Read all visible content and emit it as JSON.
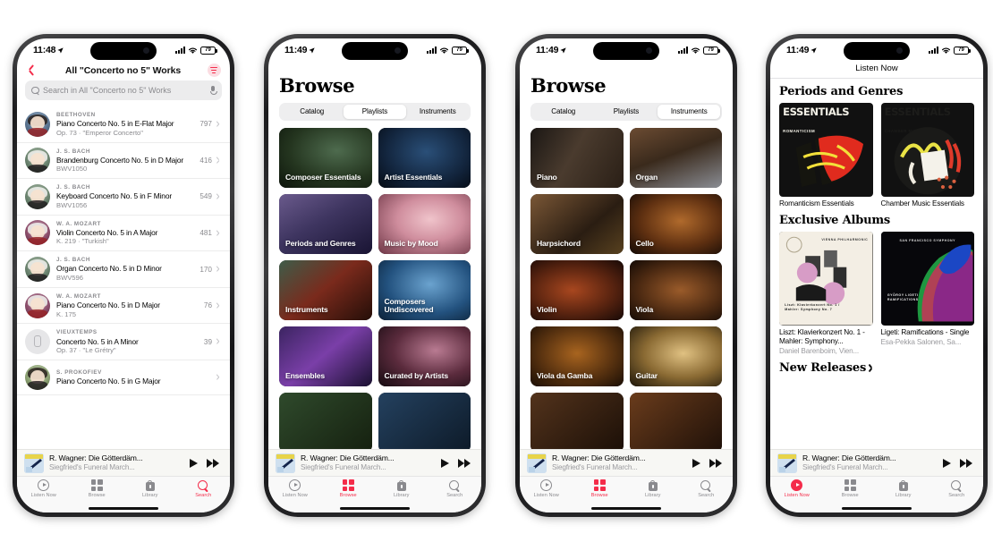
{
  "status_bar": {
    "time_p1": "11:48",
    "time_p2": "11:49",
    "time_p3": "11:49",
    "time_p4": "11:49",
    "battery": "79",
    "signal_icon": "cellular-bars-icon",
    "wifi_icon": "wifi-icon",
    "battery_icon": "battery-icon",
    "location_icon": "location-arrow-icon"
  },
  "now_playing": {
    "title": "R. Wagner: Die Götterdäm...",
    "subtitle": "Siegfried's Funeral March...",
    "play_icon": "play-icon",
    "forward_icon": "fast-forward-icon",
    "artwork_name": "now-playing-artwork"
  },
  "tab_bar": {
    "items": [
      {
        "label": "Listen Now",
        "icon": "listen-now-icon"
      },
      {
        "label": "Browse",
        "icon": "browse-grid-icon"
      },
      {
        "label": "Library",
        "icon": "library-bag-icon"
      },
      {
        "label": "Search",
        "icon": "search-magnifier-icon"
      }
    ],
    "accent_color": "#f42c4a",
    "inactive_color": "#8a8a8e"
  },
  "phone1": {
    "nav": {
      "back_icon": "back-chevron-icon",
      "title": "All \"Concerto no 5\" Works",
      "filter_icon": "filter-lines-icon"
    },
    "search": {
      "placeholder": "Search in All \"Concerto no 5\" Works",
      "search_icon": "search-magnifier-icon",
      "mic_icon": "microphone-icon"
    },
    "works": [
      {
        "composer": "BEETHOVEN",
        "title": "Piano Concerto No. 5 in E-Flat Major",
        "sub": "Op. 73 · \"Emperor Concerto\"",
        "count": "797",
        "avatar": "av-beeth"
      },
      {
        "composer": "J. S. BACH",
        "title": "Brandenburg Concerto No. 5 in D Major",
        "sub": "BWV1050",
        "count": "416",
        "avatar": "av-bach"
      },
      {
        "composer": "J. S. BACH",
        "title": "Keyboard Concerto No. 5 in F Minor",
        "sub": "BWV1056",
        "count": "549",
        "avatar": "av-bach"
      },
      {
        "composer": "W. A. MOZART",
        "title": "Violin Concerto No. 5 in A Major",
        "sub": "K. 219 · \"Turkish\"",
        "count": "481",
        "avatar": "av-moz"
      },
      {
        "composer": "J. S. BACH",
        "title": "Organ Concerto No. 5 in D Minor",
        "sub": "BWV596",
        "count": "170",
        "avatar": "av-bach"
      },
      {
        "composer": "W. A. MOZART",
        "title": "Piano Concerto No. 5 in D Major",
        "sub": "K. 175",
        "count": "76",
        "avatar": "av-moz"
      },
      {
        "composer": "VIEUXTEMPS",
        "title": "Concerto No. 5 in A Minor",
        "sub": "Op. 37 · \"Le Grétry\"",
        "count": "39",
        "avatar": "av-gray"
      },
      {
        "composer": "S. PROKOFIEV",
        "title": "Piano Concerto No. 5 in G Major",
        "sub": "",
        "count": "",
        "avatar": "av-prok"
      }
    ],
    "active_tab": "Search"
  },
  "phone2": {
    "title": "Browse",
    "segments": [
      {
        "label": "Catalog",
        "active": false
      },
      {
        "label": "Playlists",
        "active": true
      },
      {
        "label": "Instruments",
        "active": false
      }
    ],
    "cards": [
      {
        "label": "Composer Essentials",
        "art": "art-composer"
      },
      {
        "label": "Artist Essentials",
        "art": "art-artist"
      },
      {
        "label": "Periods and Genres",
        "art": "art-periods"
      },
      {
        "label": "Music by Mood",
        "art": "art-mood"
      },
      {
        "label": "Instruments",
        "art": "art-instr"
      },
      {
        "label": "Composers Undiscovered",
        "art": "art-undis"
      },
      {
        "label": "Ensembles",
        "art": "art-ens"
      },
      {
        "label": "Curated by Artists",
        "art": "art-curated"
      },
      {
        "label": "",
        "art": "art-extra1"
      },
      {
        "label": "",
        "art": "art-extra2"
      }
    ],
    "active_tab": "Browse"
  },
  "phone3": {
    "title": "Browse",
    "segments": [
      {
        "label": "Catalog",
        "active": false
      },
      {
        "label": "Playlists",
        "active": false
      },
      {
        "label": "Instruments",
        "active": true
      }
    ],
    "cards": [
      {
        "label": "Piano",
        "art": "art-piano"
      },
      {
        "label": "Organ",
        "art": "art-organ"
      },
      {
        "label": "Harpsichord",
        "art": "art-harps"
      },
      {
        "label": "Cello",
        "art": "art-cello"
      },
      {
        "label": "Violin",
        "art": "art-violin"
      },
      {
        "label": "Viola",
        "art": "art-viola"
      },
      {
        "label": "Viola da Gamba",
        "art": "art-gamba"
      },
      {
        "label": "Guitar",
        "art": "art-guitar"
      },
      {
        "label": "",
        "art": "art-extra3"
      },
      {
        "label": "",
        "art": "art-extra4"
      }
    ],
    "active_tab": "Browse"
  },
  "phone4": {
    "nav_title": "Listen Now",
    "sections": [
      {
        "heading": "Periods and Genres",
        "has_arrow": false,
        "tiles": [
          {
            "cover": "ess1",
            "badge": "ESSENTIALS",
            "badge_sub": "ROMANTICISM",
            "label": "Romanticism Essentials",
            "sub": ""
          },
          {
            "cover": "ess2",
            "badge": "ESSENTIALS",
            "badge_sub": "CHAMBER MUSIC",
            "label": "Chamber Music Essentials",
            "sub": ""
          }
        ]
      },
      {
        "heading": "Exclusive Albums",
        "has_arrow": false,
        "tiles": [
          {
            "cover": "alb-liszt",
            "badge": "VIENNA PHILHARMONIC",
            "badge_sub": "Liszt: Klavierkonzert No. 1 / Mahler: Symphony No. 7",
            "label": "Liszt: Klavierkonzert No. 1 - Mahler: Symphony...",
            "sub": "Daniel Barenboim, Vien..."
          },
          {
            "cover": "alb-ligeti",
            "badge": "SAN FRANCISCO SYMPHONY",
            "badge_sub": "GYÖRGY LIGETI RAMIFICATIONS",
            "label": "Ligeti: Ramifications - Single",
            "sub": "Esa-Pekka Salonen, Sa..."
          }
        ]
      },
      {
        "heading": "New Releases",
        "has_arrow": true,
        "tiles": []
      }
    ],
    "active_tab": "Listen Now"
  }
}
